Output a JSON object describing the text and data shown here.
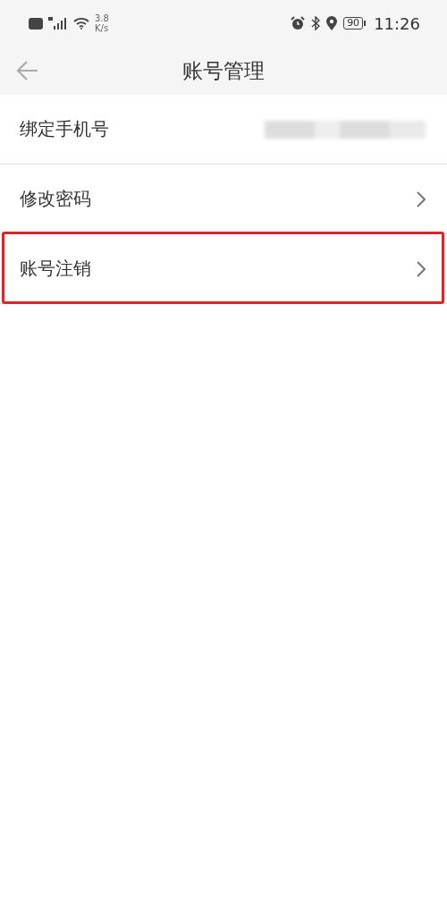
{
  "status_bar": {
    "network_speed": "3.8",
    "network_speed_unit": "K/s",
    "battery": "90",
    "time": "11:26"
  },
  "header": {
    "title": "账号管理"
  },
  "rows": [
    {
      "label": "绑定手机号",
      "kind": "masked",
      "highlighted": false
    },
    {
      "label": "修改密码",
      "kind": "link",
      "highlighted": false
    },
    {
      "label": "账号注销",
      "kind": "link",
      "highlighted": true
    }
  ]
}
